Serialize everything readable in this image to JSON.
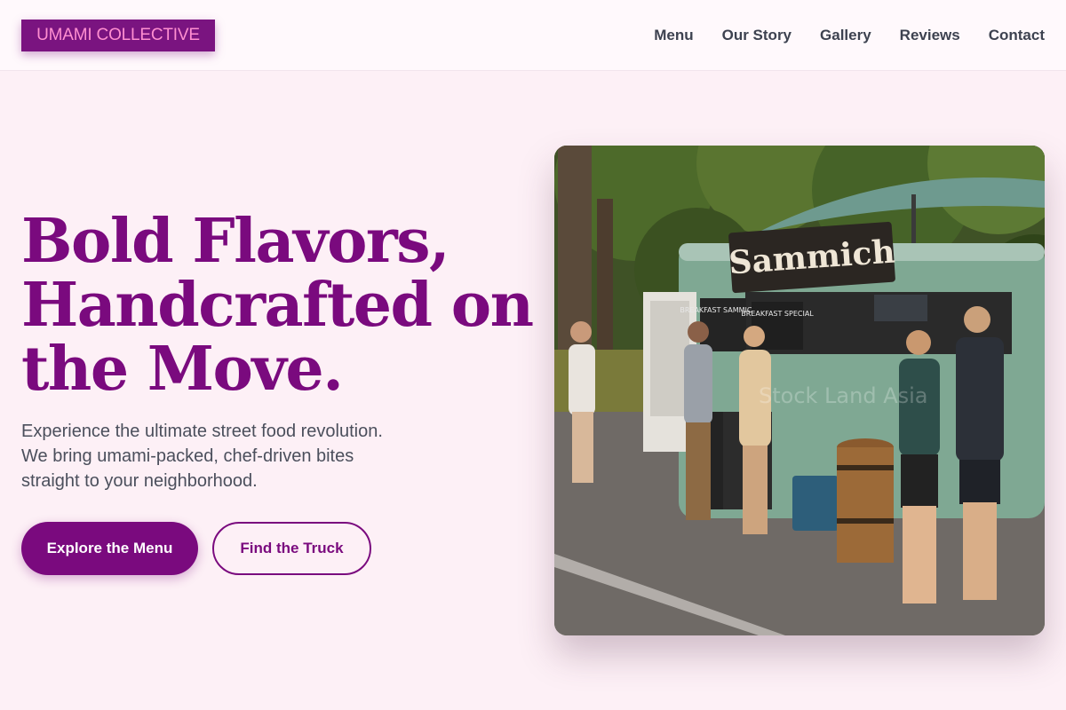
{
  "header": {
    "logo": "UMAMI COLLECTIVE",
    "nav": [
      "Menu",
      "Our Story",
      "Gallery",
      "Reviews",
      "Contact"
    ]
  },
  "hero": {
    "headline_lines": [
      "Bold Flavors,",
      "Handcrafted on",
      "the Move."
    ],
    "subtitle_lines": [
      "Experience the ultimate street food revolution.",
      "We bring umami-packed, chef-driven bites",
      "straight to your neighborhood."
    ],
    "primary_cta": "Explore the Menu",
    "secondary_cta": "Find the Truck"
  },
  "photo": {
    "sign_text": "Sammich",
    "board_left": "BREAKFAST SAMMICHES",
    "board_right": "BREAKFAST SPECIAL",
    "watermark": "Stock Land Asia"
  },
  "colors": {
    "brand": "#7a0a7e",
    "logo_text": "#ff8fd0",
    "background": "#fdf0f6",
    "header_bg": "#fff9fc",
    "body_text": "#4b4f5c"
  }
}
